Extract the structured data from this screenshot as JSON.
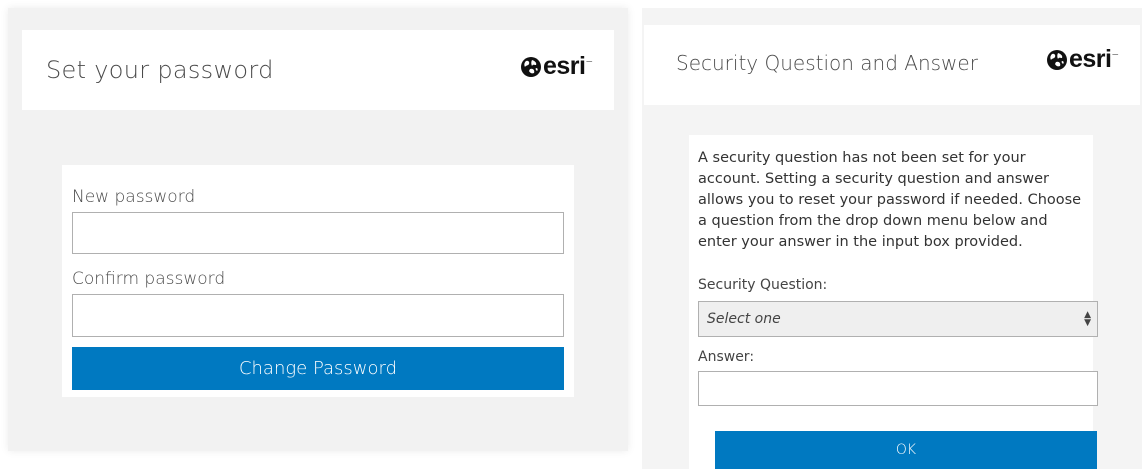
{
  "brand": {
    "logo_text": "esri",
    "accent_color": "#0079c1"
  },
  "set_password": {
    "title": "Set your password",
    "new_password_label": "New password",
    "confirm_password_label": "Confirm password",
    "submit_label": "Change Password"
  },
  "security_question": {
    "title": "Security Question and Answer",
    "intro": "A security question has not been set for your account. Setting a security question and answer allows you to reset your password if needed. Choose a question from the drop down menu below and enter your answer in the input box provided.",
    "question_label": "Security Question:",
    "question_selected": "Select one",
    "answer_label": "Answer:",
    "submit_label": "OK"
  },
  "icons": {
    "logo_globe": "globe-icon",
    "select_arrows": "updown-arrows-icon"
  }
}
